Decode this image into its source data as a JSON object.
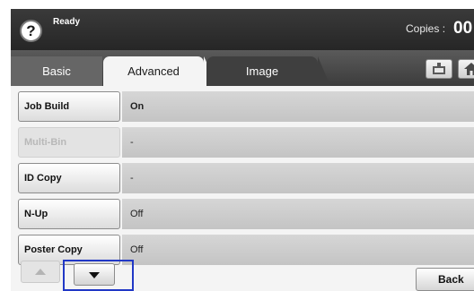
{
  "status": {
    "help_label": "?",
    "text": "Ready",
    "copies_label": "Copies :",
    "copies_value": "00"
  },
  "tabs": [
    {
      "label": "Basic",
      "active": false
    },
    {
      "label": "Advanced",
      "active": true
    },
    {
      "label": "Image",
      "active": false
    }
  ],
  "toolbar": {
    "icons": [
      "job-status-icon",
      "home-icon"
    ]
  },
  "rows": [
    {
      "label": "Job Build",
      "value": "On",
      "enabled": true
    },
    {
      "label": "Multi-Bin",
      "value": "-",
      "enabled": false
    },
    {
      "label": "ID Copy",
      "value": "-",
      "enabled": true
    },
    {
      "label": "N-Up",
      "value": "Off",
      "enabled": true
    },
    {
      "label": "Poster Copy",
      "value": "Off",
      "enabled": true
    }
  ],
  "nav": {
    "up_icon": "arrow-up-icon",
    "down_icon": "arrow-down-icon",
    "back_label": "Back"
  },
  "colors": {
    "highlight": "#2138c6",
    "header": "#2e2e2e"
  }
}
